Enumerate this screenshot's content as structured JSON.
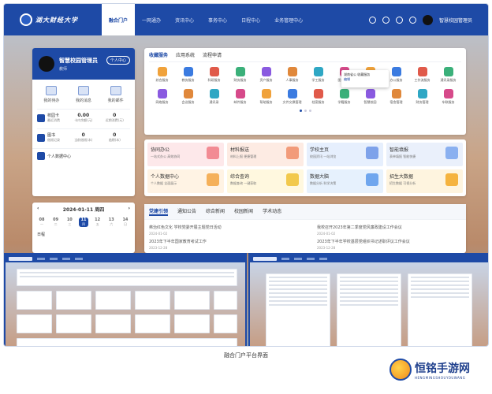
{
  "header": {
    "logo_text": "湖大财经大学",
    "nav": [
      "融合门户",
      "一网通办",
      "资讯中心",
      "事务中心",
      "日程中心",
      "业务管理中心"
    ],
    "user_name": "智慧校园管理员"
  },
  "profile": {
    "name": "智慧校园管理员",
    "role": "教师",
    "switch_label": "个人中心",
    "quick": [
      "我的待办",
      "我的消息",
      "我的邮件"
    ],
    "stats": [
      {
        "label": "校园卡",
        "sub": "最近消费",
        "v1": "0.00",
        "v1sub": "卡内余额(元)",
        "v2": "0",
        "v2sub": "近期消费(元)"
      },
      {
        "label": "图书",
        "sub": "借阅记录",
        "v1": "0",
        "v1sub": "当前借阅(本)",
        "v2": "0",
        "v2sub": "逾期(本)"
      }
    ],
    "center_label": "个人数据中心"
  },
  "calendar": {
    "date_label": "2024-01-11 周四",
    "days": [
      {
        "d": "08",
        "w": "一"
      },
      {
        "d": "09",
        "w": "二"
      },
      {
        "d": "10",
        "w": "三"
      },
      {
        "d": "11",
        "w": "四"
      },
      {
        "d": "12",
        "w": "五"
      },
      {
        "d": "13",
        "w": "六"
      },
      {
        "d": "14",
        "w": "日"
      }
    ],
    "footer": "日程"
  },
  "apps": {
    "tabs": [
      "收藏服务",
      "应用系统",
      "流程申请"
    ],
    "items": [
      "综合服务",
      "教务服务",
      "科研服务",
      "财务服务",
      "资产服务",
      "人事服务",
      "学工服务",
      "图书服务",
      "后勤服务",
      "办公服务",
      "工作流服务",
      "通讯录服务",
      "网络服务",
      "会议服务",
      "通讯录",
      "邮件服务",
      "帮助服务",
      "文件交换管理",
      "档案服务",
      "学籍服务",
      "智慧校园",
      "宿舍管理",
      "财务管理",
      "车联服务"
    ],
    "popup_line1": "湖南省公 收藏服务",
    "popup_line2": "编辑"
  },
  "services": [
    {
      "title": "协同办公",
      "sub": "一站式办公 高效协同"
    },
    {
      "title": "材料报送",
      "sub": "材料上报 便捷管理"
    },
    {
      "title": "学校主页",
      "sub": "校园资讯 一站浏览"
    },
    {
      "title": "智能填报",
      "sub": "表单填报 智能快捷"
    },
    {
      "title": "个人数据中心",
      "sub": "个人数据 全面展示"
    },
    {
      "title": "综合查询",
      "sub": "数据查询 一键获取"
    },
    {
      "title": "数据大脑",
      "sub": "数据分析 科学决策"
    },
    {
      "title": "招生大数据",
      "sub": "招生数据 可视分析"
    }
  ],
  "news": {
    "tabs": [
      "党建引领",
      "通知公告",
      "综合新闻",
      "校园新闻",
      "学术动态"
    ],
    "left": [
      {
        "title": "弗治红色文化 学校党委开展主题党日活动",
        "date": "2024-01-02"
      },
      {
        "title": "2023年下半年国家教育考试工作",
        "date": "2023-12-28"
      }
    ],
    "right": [
      {
        "title": "我校召开2023年第二季度党风廉政建设工作会议",
        "date": "2024-01-02"
      },
      {
        "title": "2023年下半年学校基层党组织书记述职评议工作会议",
        "date": "2023-12-28"
      }
    ]
  },
  "caption": "融合门户平台界面",
  "watermark": {
    "title": "恒铭手游网",
    "sub": "HENGMINGSHOUYOUWANG"
  }
}
